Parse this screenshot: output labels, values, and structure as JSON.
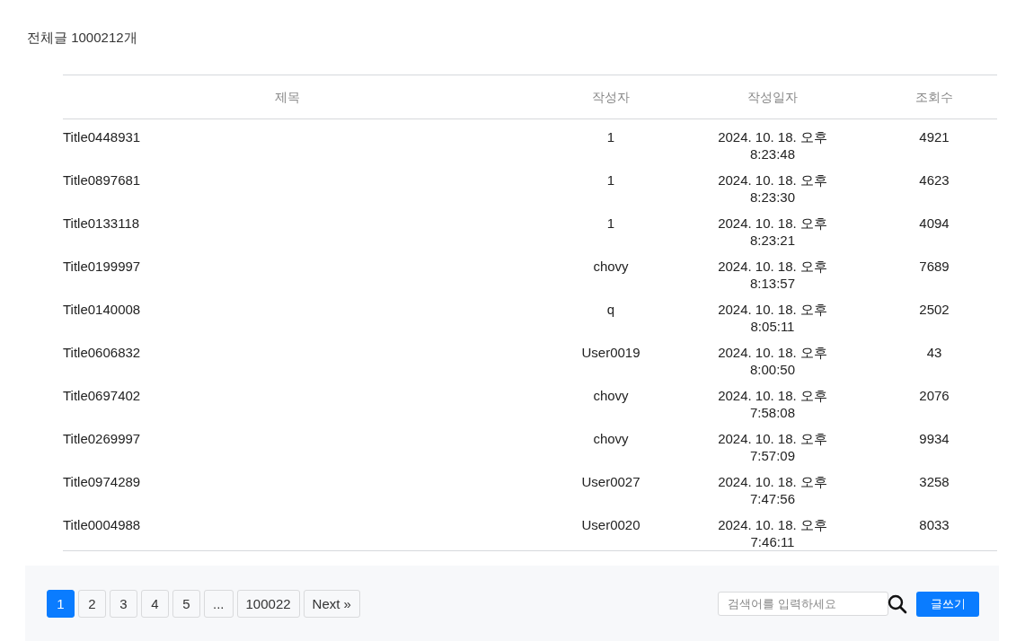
{
  "total_label": "전체글 1000212개",
  "table": {
    "columns": [
      "제목",
      "작성자",
      "작성일자",
      "조회수"
    ],
    "rows": [
      {
        "title": "Title0448931",
        "author": "1",
        "date": "2024. 10. 18. 오후 8:23:48",
        "views": "4921"
      },
      {
        "title": "Title0897681",
        "author": "1",
        "date": "2024. 10. 18. 오후 8:23:30",
        "views": "4623"
      },
      {
        "title": "Title0133118",
        "author": "1",
        "date": "2024. 10. 18. 오후 8:23:21",
        "views": "4094"
      },
      {
        "title": "Title0199997",
        "author": "chovy",
        "date": "2024. 10. 18. 오후 8:13:57",
        "views": "7689"
      },
      {
        "title": "Title0140008",
        "author": "q",
        "date": "2024. 10. 18. 오후 8:05:11",
        "views": "2502"
      },
      {
        "title": "Title0606832",
        "author": "User0019",
        "date": "2024. 10. 18. 오후 8:00:50",
        "views": "43"
      },
      {
        "title": "Title0697402",
        "author": "chovy",
        "date": "2024. 10. 18. 오후 7:58:08",
        "views": "2076"
      },
      {
        "title": "Title0269997",
        "author": "chovy",
        "date": "2024. 10. 18. 오후 7:57:09",
        "views": "9934"
      },
      {
        "title": "Title0974289",
        "author": "User0027",
        "date": "2024. 10. 18. 오후 7:47:56",
        "views": "3258"
      },
      {
        "title": "Title0004988",
        "author": "User0020",
        "date": "2024. 10. 18. 오후 7:46:11",
        "views": "8033"
      }
    ]
  },
  "pagination": [
    {
      "label": "1",
      "selected": true
    },
    {
      "label": "2",
      "selected": false
    },
    {
      "label": "3",
      "selected": false
    },
    {
      "label": "4",
      "selected": false
    },
    {
      "label": "5",
      "selected": false
    },
    {
      "label": "...",
      "selected": false
    },
    {
      "label": "100022",
      "selected": false
    },
    {
      "label": "Next »",
      "selected": false
    }
  ],
  "search": {
    "placeholder": "검색어를 입력하세요"
  },
  "write_button": "글쓰기"
}
